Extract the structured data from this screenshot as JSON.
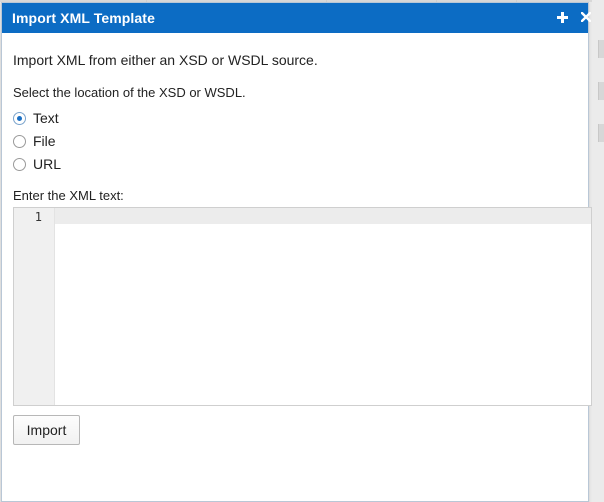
{
  "dialog": {
    "title": "Import XML Template",
    "maximize_icon": "plus-icon",
    "close_icon": "close-icon",
    "intro": "Import XML from either an XSD or WSDL source.",
    "select_label": "Select the location of the XSD or WSDL.",
    "source_options": [
      {
        "label": "Text",
        "selected": true
      },
      {
        "label": "File",
        "selected": false
      },
      {
        "label": "URL",
        "selected": false
      }
    ],
    "editor_label": "Enter the XML text:",
    "editor": {
      "line_numbers": [
        "1"
      ],
      "value": ""
    },
    "import_label": "Import"
  },
  "colors": {
    "title_bar": "#0c6cc4",
    "radio_selected": "#1a6fc4"
  }
}
